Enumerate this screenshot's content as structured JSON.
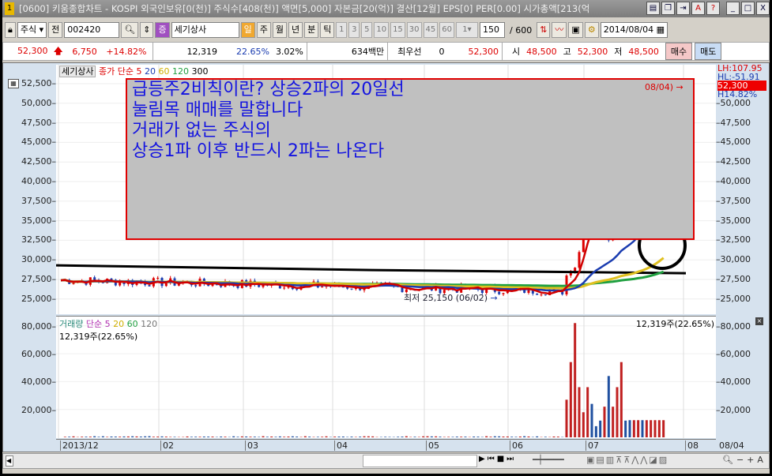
{
  "window": {
    "title": "[0600] 키움종합차트 - KOSPI 외국인보유[0(천)] 주식수[408(천)] 액면[5,000] 자본금[20(억)] 결산[12월] EPS[0] PER[0.00] 시가총액[213(억"
  },
  "toolbar": {
    "market": "주식",
    "jeon": "전",
    "code": "002420",
    "jeung": "증",
    "name": "세기상사",
    "periods": [
      "일",
      "주",
      "월",
      "년",
      "분",
      "틱"
    ],
    "minutes": [
      "1",
      "3",
      "5",
      "10",
      "15",
      "30",
      "45",
      "60"
    ],
    "min_value": "1",
    "count": "150",
    "max": "/ 600",
    "date": "2014/08/04"
  },
  "quote": {
    "price": "52,300",
    "change": "6,750",
    "rate": "+14.82%",
    "volume": "12,319",
    "vol_rate": "22.65%",
    "turnover": "3.02%",
    "amount": "634백만",
    "best_label": "최우선",
    "best": "0",
    "best_price": "52,300",
    "open_label": "시",
    "open": "48,500",
    "high_label": "고",
    "high": "52,300",
    "low_label": "저",
    "low": "48,500",
    "buy": "매수",
    "sell": "매도"
  },
  "price_pane": {
    "legend_name": "세기상사",
    "legend_type": "종가 단순",
    "ma": [
      "5",
      "20",
      "60",
      "120",
      "300"
    ],
    "ma_colors": [
      "#d00000",
      "#1a3cb0",
      "#e0c020",
      "#20a040",
      "#000000"
    ],
    "y_ticks": [
      "52,500",
      "50,000",
      "47,500",
      "45,000",
      "42,500",
      "40,000",
      "37,500",
      "35,000",
      "32,500",
      "30,000",
      "27,500",
      "25,000"
    ],
    "right_ticks": [
      "50,000",
      "47,500",
      "45,000",
      "42,500",
      "40,000",
      "37,500",
      "35,000",
      "32,500",
      "30,000",
      "27,500",
      "25,000"
    ],
    "lh": "LH:107.95",
    "hl": "HL:-51.91",
    "last": "52,300",
    "pct": "H14.82%",
    "high_note": "08/04)",
    "low_note": "최저 25,150 (06/02)"
  },
  "annotation": {
    "lines": [
      "급등주2비칙이란? 상승2파의 20일선",
      "눌림목 매매를 말합니다",
      "거래가 없는 주식의",
      "상승1파 이후 반드시 2파는 나온다"
    ]
  },
  "volume_pane": {
    "legend_name": "거래량",
    "legend_type": "단순",
    "ma": [
      "5",
      "20",
      "60",
      "120"
    ],
    "current": "12,319주(22.65%)",
    "y_ticks": [
      "80,000",
      "60,000",
      "40,000",
      "20,000"
    ]
  },
  "x_axis": {
    "labels": [
      "2013/12",
      "02",
      "03",
      "04",
      "05",
      "06",
      "07",
      "08"
    ],
    "last": "08/04"
  }
}
